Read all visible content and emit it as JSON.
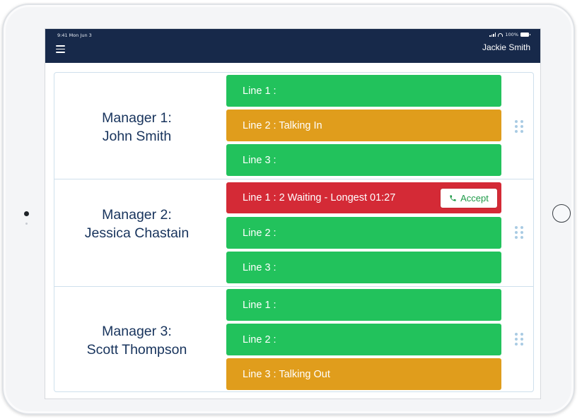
{
  "status_bar": {
    "time": "9:41  Mon Jun 3",
    "battery": "100%"
  },
  "header": {
    "user_name": "Jackie Smith"
  },
  "managers": [
    {
      "name_line1": "Manager 1:",
      "name_line2": "John Smith",
      "lines": [
        {
          "label": "Line 1 :",
          "status": "available",
          "color": "#22c25c"
        },
        {
          "label": "Line 2 : Talking In",
          "status": "talking",
          "color": "#e09d1c"
        },
        {
          "label": "Line 3 :",
          "status": "available",
          "color": "#22c25c"
        }
      ]
    },
    {
      "name_line1": "Manager 2:",
      "name_line2": "Jessica Chastain",
      "lines": [
        {
          "label": "Line 1 :  2 Waiting  -  Longest 01:27",
          "status": "waiting",
          "color": "#d42a36",
          "action_label": "Accept",
          "action_icon": "phone-icon"
        },
        {
          "label": "Line 2 :",
          "status": "available",
          "color": "#22c25c"
        },
        {
          "label": "Line 3 :",
          "status": "available",
          "color": "#22c25c"
        }
      ]
    },
    {
      "name_line1": "Manager 3:",
      "name_line2": "Scott Thompson",
      "lines": [
        {
          "label": "Line 1 :",
          "status": "available",
          "color": "#22c25c"
        },
        {
          "label": "Line 2 :",
          "status": "available",
          "color": "#22c25c"
        },
        {
          "label": "Line 3 : Talking Out",
          "status": "talking",
          "color": "#e09d1c"
        }
      ]
    }
  ],
  "colors": {
    "header_bg": "#17294a",
    "manager_text": "#17335c",
    "available": "#22c25c",
    "talking": "#e09d1c",
    "waiting": "#d42a36",
    "accept_text": "#1e9a48"
  },
  "icons": {
    "menu": "hamburger-menu-icon",
    "drag": "drag-handle-icon",
    "accept": "phone-icon"
  }
}
